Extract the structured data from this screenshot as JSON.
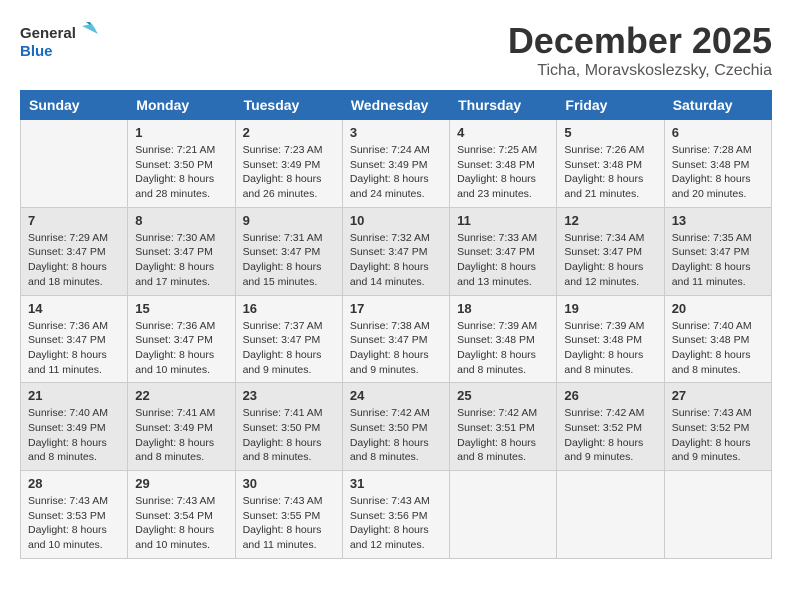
{
  "logo": {
    "line1": "General",
    "line2": "Blue"
  },
  "title": "December 2025",
  "subtitle": "Ticha, Moravskoslezsky, Czechia",
  "days_of_week": [
    "Sunday",
    "Monday",
    "Tuesday",
    "Wednesday",
    "Thursday",
    "Friday",
    "Saturday"
  ],
  "weeks": [
    [
      {
        "day": "",
        "sunrise": "",
        "sunset": "",
        "daylight": ""
      },
      {
        "day": "1",
        "sunrise": "Sunrise: 7:21 AM",
        "sunset": "Sunset: 3:50 PM",
        "daylight": "Daylight: 8 hours and 28 minutes."
      },
      {
        "day": "2",
        "sunrise": "Sunrise: 7:23 AM",
        "sunset": "Sunset: 3:49 PM",
        "daylight": "Daylight: 8 hours and 26 minutes."
      },
      {
        "day": "3",
        "sunrise": "Sunrise: 7:24 AM",
        "sunset": "Sunset: 3:49 PM",
        "daylight": "Daylight: 8 hours and 24 minutes."
      },
      {
        "day": "4",
        "sunrise": "Sunrise: 7:25 AM",
        "sunset": "Sunset: 3:48 PM",
        "daylight": "Daylight: 8 hours and 23 minutes."
      },
      {
        "day": "5",
        "sunrise": "Sunrise: 7:26 AM",
        "sunset": "Sunset: 3:48 PM",
        "daylight": "Daylight: 8 hours and 21 minutes."
      },
      {
        "day": "6",
        "sunrise": "Sunrise: 7:28 AM",
        "sunset": "Sunset: 3:48 PM",
        "daylight": "Daylight: 8 hours and 20 minutes."
      }
    ],
    [
      {
        "day": "7",
        "sunrise": "Sunrise: 7:29 AM",
        "sunset": "Sunset: 3:47 PM",
        "daylight": "Daylight: 8 hours and 18 minutes."
      },
      {
        "day": "8",
        "sunrise": "Sunrise: 7:30 AM",
        "sunset": "Sunset: 3:47 PM",
        "daylight": "Daylight: 8 hours and 17 minutes."
      },
      {
        "day": "9",
        "sunrise": "Sunrise: 7:31 AM",
        "sunset": "Sunset: 3:47 PM",
        "daylight": "Daylight: 8 hours and 15 minutes."
      },
      {
        "day": "10",
        "sunrise": "Sunrise: 7:32 AM",
        "sunset": "Sunset: 3:47 PM",
        "daylight": "Daylight: 8 hours and 14 minutes."
      },
      {
        "day": "11",
        "sunrise": "Sunrise: 7:33 AM",
        "sunset": "Sunset: 3:47 PM",
        "daylight": "Daylight: 8 hours and 13 minutes."
      },
      {
        "day": "12",
        "sunrise": "Sunrise: 7:34 AM",
        "sunset": "Sunset: 3:47 PM",
        "daylight": "Daylight: 8 hours and 12 minutes."
      },
      {
        "day": "13",
        "sunrise": "Sunrise: 7:35 AM",
        "sunset": "Sunset: 3:47 PM",
        "daylight": "Daylight: 8 hours and 11 minutes."
      }
    ],
    [
      {
        "day": "14",
        "sunrise": "Sunrise: 7:36 AM",
        "sunset": "Sunset: 3:47 PM",
        "daylight": "Daylight: 8 hours and 11 minutes."
      },
      {
        "day": "15",
        "sunrise": "Sunrise: 7:36 AM",
        "sunset": "Sunset: 3:47 PM",
        "daylight": "Daylight: 8 hours and 10 minutes."
      },
      {
        "day": "16",
        "sunrise": "Sunrise: 7:37 AM",
        "sunset": "Sunset: 3:47 PM",
        "daylight": "Daylight: 8 hours and 9 minutes."
      },
      {
        "day": "17",
        "sunrise": "Sunrise: 7:38 AM",
        "sunset": "Sunset: 3:47 PM",
        "daylight": "Daylight: 8 hours and 9 minutes."
      },
      {
        "day": "18",
        "sunrise": "Sunrise: 7:39 AM",
        "sunset": "Sunset: 3:48 PM",
        "daylight": "Daylight: 8 hours and 8 minutes."
      },
      {
        "day": "19",
        "sunrise": "Sunrise: 7:39 AM",
        "sunset": "Sunset: 3:48 PM",
        "daylight": "Daylight: 8 hours and 8 minutes."
      },
      {
        "day": "20",
        "sunrise": "Sunrise: 7:40 AM",
        "sunset": "Sunset: 3:48 PM",
        "daylight": "Daylight: 8 hours and 8 minutes."
      }
    ],
    [
      {
        "day": "21",
        "sunrise": "Sunrise: 7:40 AM",
        "sunset": "Sunset: 3:49 PM",
        "daylight": "Daylight: 8 hours and 8 minutes."
      },
      {
        "day": "22",
        "sunrise": "Sunrise: 7:41 AM",
        "sunset": "Sunset: 3:49 PM",
        "daylight": "Daylight: 8 hours and 8 minutes."
      },
      {
        "day": "23",
        "sunrise": "Sunrise: 7:41 AM",
        "sunset": "Sunset: 3:50 PM",
        "daylight": "Daylight: 8 hours and 8 minutes."
      },
      {
        "day": "24",
        "sunrise": "Sunrise: 7:42 AM",
        "sunset": "Sunset: 3:50 PM",
        "daylight": "Daylight: 8 hours and 8 minutes."
      },
      {
        "day": "25",
        "sunrise": "Sunrise: 7:42 AM",
        "sunset": "Sunset: 3:51 PM",
        "daylight": "Daylight: 8 hours and 8 minutes."
      },
      {
        "day": "26",
        "sunrise": "Sunrise: 7:42 AM",
        "sunset": "Sunset: 3:52 PM",
        "daylight": "Daylight: 8 hours and 9 minutes."
      },
      {
        "day": "27",
        "sunrise": "Sunrise: 7:43 AM",
        "sunset": "Sunset: 3:52 PM",
        "daylight": "Daylight: 8 hours and 9 minutes."
      }
    ],
    [
      {
        "day": "28",
        "sunrise": "Sunrise: 7:43 AM",
        "sunset": "Sunset: 3:53 PM",
        "daylight": "Daylight: 8 hours and 10 minutes."
      },
      {
        "day": "29",
        "sunrise": "Sunrise: 7:43 AM",
        "sunset": "Sunset: 3:54 PM",
        "daylight": "Daylight: 8 hours and 10 minutes."
      },
      {
        "day": "30",
        "sunrise": "Sunrise: 7:43 AM",
        "sunset": "Sunset: 3:55 PM",
        "daylight": "Daylight: 8 hours and 11 minutes."
      },
      {
        "day": "31",
        "sunrise": "Sunrise: 7:43 AM",
        "sunset": "Sunset: 3:56 PM",
        "daylight": "Daylight: 8 hours and 12 minutes."
      },
      {
        "day": "",
        "sunrise": "",
        "sunset": "",
        "daylight": ""
      },
      {
        "day": "",
        "sunrise": "",
        "sunset": "",
        "daylight": ""
      },
      {
        "day": "",
        "sunrise": "",
        "sunset": "",
        "daylight": ""
      }
    ]
  ]
}
